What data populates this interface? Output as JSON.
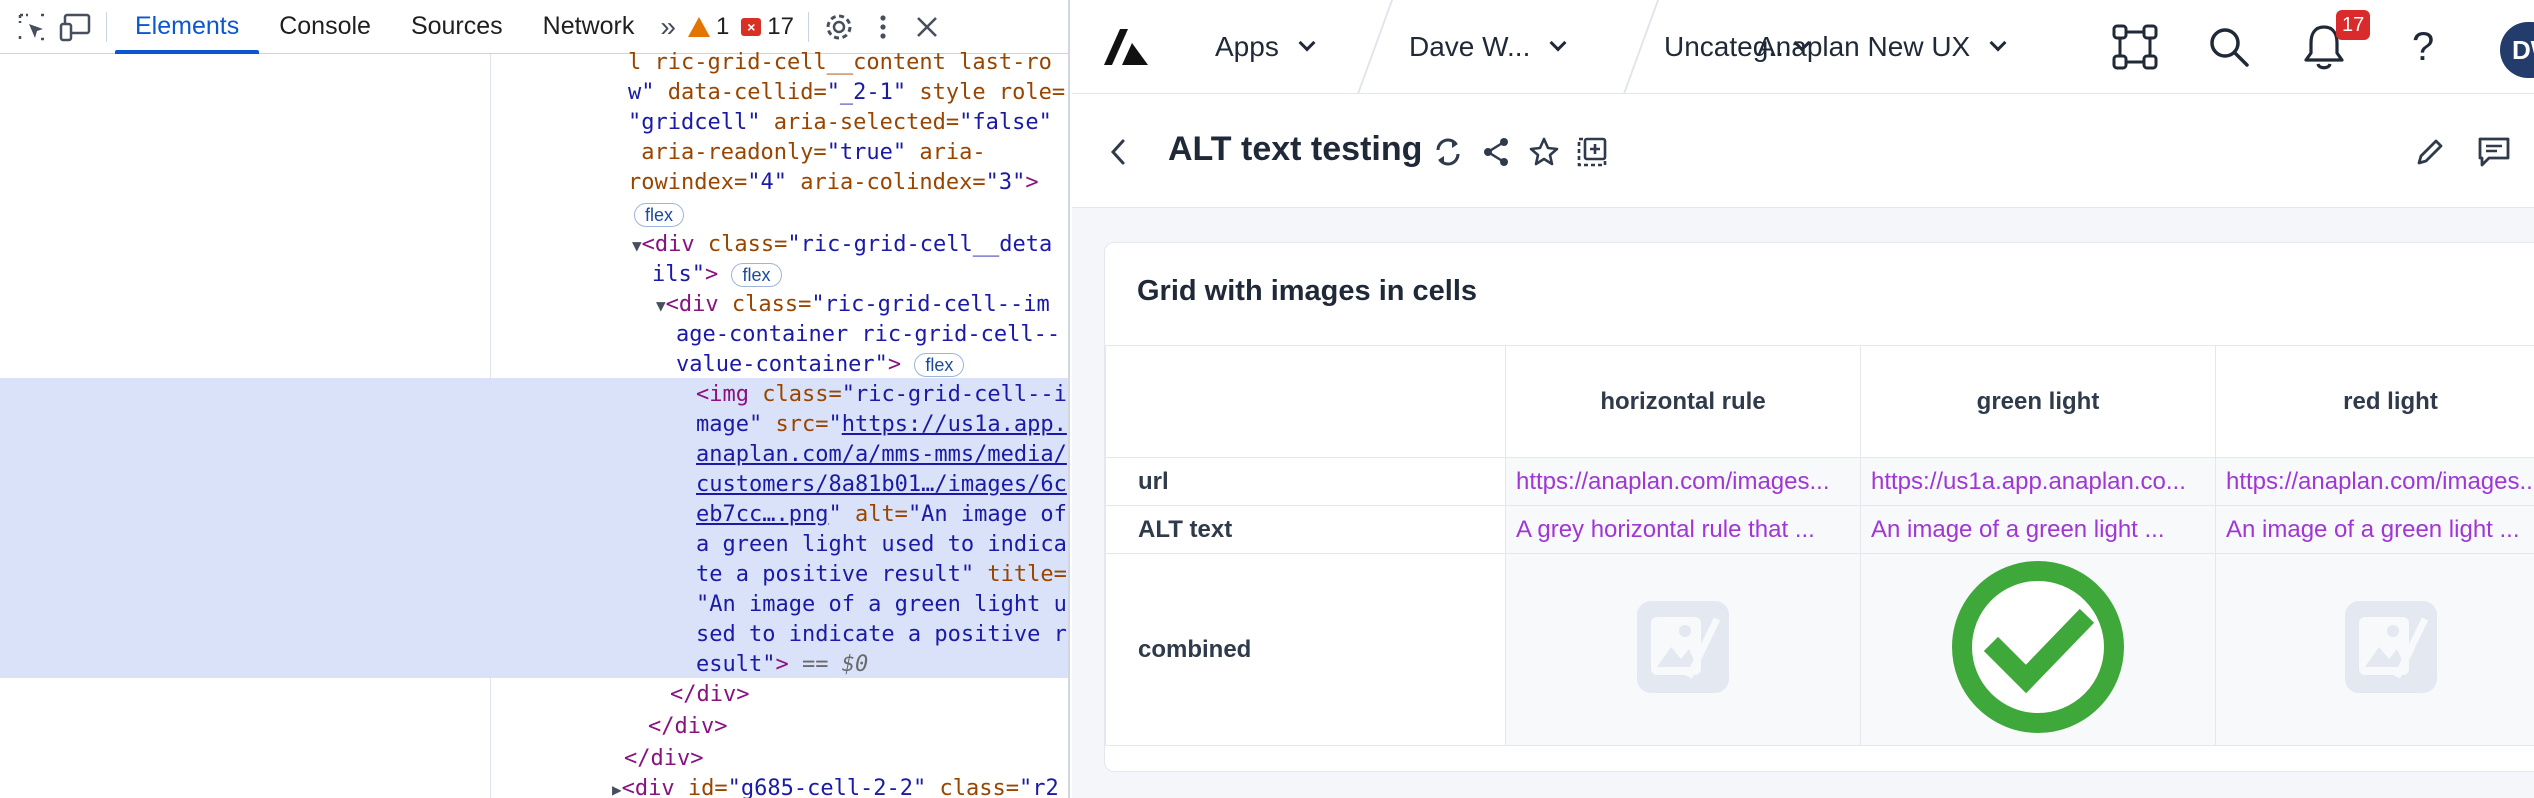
{
  "devtools": {
    "tabs": [
      {
        "label": "Elements",
        "active": true
      },
      {
        "label": "Console",
        "active": false
      },
      {
        "label": "Sources",
        "active": false
      },
      {
        "label": "Network",
        "active": false
      }
    ],
    "more_tabs_icon": "double-chevron-right-icon",
    "warning_count": "1",
    "error_count": "17",
    "code_lines": {
      "l1_a": "l ric-grid-cell__content last-ro",
      "l2_a": "w\"",
      "l2_b": " data-cellid=",
      "l2_c": "\"_2-1\"",
      "l2_d": " style role=",
      "l3_a": "\"gridcell\"",
      "l3_b": " aria-selected=",
      "l3_c": "\"false\"",
      "l4_a": " aria-readonly=",
      "l4_b": "\"true\"",
      "l4_c": " aria-",
      "l5_a": "rowindex=",
      "l5_b": "\"4\"",
      "l5_c": " aria-colindex=",
      "l5_d": "\"3\"",
      "l5_e": ">",
      "l7_a": "<div",
      "l7_b": " class=",
      "l7_c": "\"ric-grid-cell__deta",
      "l8_a": "ils\"",
      "l8_b": ">",
      "l9_a": "<div",
      "l9_b": " class=",
      "l9_c": "\"ric-grid-cell--im",
      "l10_a": "age-container ric-grid-cell--",
      "l11_a": "value-container\"",
      "l11_b": ">",
      "l12_a": "<img",
      "l12_b": " class=",
      "l12_c": "\"ric-grid-cell--i",
      "l13_a": "mage\"",
      "l13_b": " src=",
      "l13_c": "\"",
      "l13_d": "https://us1a.app.",
      "l14_a": "anaplan.com/a/mms-mms/media/",
      "l15_a": "customers/8a81b01…/images/6c",
      "l16_a": "eb7cc….png",
      "l16_b": "\"",
      "l16_c": " alt=",
      "l16_d": "\"An image of",
      "l17_a": "a green light used to indica",
      "l18_a": "te a positive result\"",
      "l18_b": " title=",
      "l19_a": "\"An image of a green light u",
      "l20_a": "sed to indicate a positive r",
      "l21_a": "esult\"",
      "l21_b": ">",
      "l21_c": " == $0",
      "l22_a": "</div>",
      "l23_a": "</div>",
      "l24_a": "</div>",
      "l25_a": "<div",
      "l25_b": " id=",
      "l25_c": "\"g685-cell-2-2\"",
      "l25_d": " class=",
      "l25_e": "\"r2",
      "flex": "flex"
    }
  },
  "app": {
    "logo_icon": "anaplan-logo-icon",
    "nav": {
      "apps": "Apps",
      "user": "Dave W...",
      "category": "Uncateg...",
      "workspace": "Anaplan New UX"
    },
    "notification_count": "17",
    "help": "?",
    "avatar": "DW",
    "page_title": "ALT text testing",
    "card_title": "Grid with images in cells",
    "grid": {
      "columns": [
        "horizontal rule",
        "green light",
        "red light"
      ],
      "rows": {
        "url": {
          "label": "url",
          "values": [
            "https://anaplan.com/images...",
            "https://us1a.app.anaplan.co...",
            "https://anaplan.com/images..."
          ]
        },
        "alt": {
          "label": "ALT text",
          "values": [
            "A grey horizontal rule that ...",
            "An image of a green light ...",
            "An image of a green light ..."
          ]
        },
        "combined": {
          "label": "combined",
          "images": [
            "broken-image-placeholder-icon",
            "green-checkmark-icon",
            "broken-image-placeholder-icon"
          ]
        }
      }
    },
    "colors": {
      "link_purple": "#a036d6",
      "success_green": "#3fa83a",
      "badge_red": "#d92b2b",
      "devtools_active": "#0b57d0"
    }
  }
}
